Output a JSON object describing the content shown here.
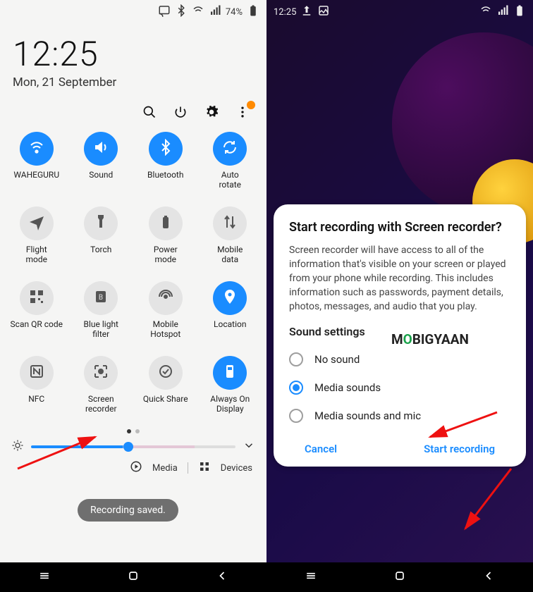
{
  "left": {
    "status": {
      "battery_pct": "74%"
    },
    "clock": {
      "time": "12:25",
      "date": "Mon, 21 September"
    },
    "toolbar": {
      "more_badge": "N"
    },
    "tiles": [
      {
        "id": "wifi",
        "label": "WAHEGURU",
        "on": true
      },
      {
        "id": "sound",
        "label": "Sound",
        "on": true
      },
      {
        "id": "bluetooth",
        "label": "Bluetooth",
        "on": true
      },
      {
        "id": "autorotate",
        "label": "Auto\nrotate",
        "on": true
      },
      {
        "id": "flightmode",
        "label": "Flight\nmode",
        "on": false
      },
      {
        "id": "torch",
        "label": "Torch",
        "on": false
      },
      {
        "id": "powermode",
        "label": "Power\nmode",
        "on": false
      },
      {
        "id": "mobiledata",
        "label": "Mobile\ndata",
        "on": false
      },
      {
        "id": "qrcode",
        "label": "Scan QR code",
        "on": false
      },
      {
        "id": "bluelight",
        "label": "Blue light\nfilter",
        "on": false
      },
      {
        "id": "hotspot",
        "label": "Mobile\nHotspot",
        "on": false
      },
      {
        "id": "location",
        "label": "Location",
        "on": true
      },
      {
        "id": "nfc",
        "label": "NFC",
        "on": false
      },
      {
        "id": "screenrec",
        "label": "Screen\nrecorder",
        "on": false
      },
      {
        "id": "quickshare",
        "label": "Quick Share",
        "on": false
      },
      {
        "id": "aod",
        "label": "Always On\nDisplay",
        "on": true
      }
    ],
    "snackbar": "Recording saved.",
    "bottom": {
      "media": "Media",
      "devices": "Devices"
    }
  },
  "right": {
    "status_time": "12:25",
    "dialog": {
      "title": "Start recording with Screen recorder?",
      "body": "Screen recorder will have access to all of the information that's visible on your screen or played from your phone while recording. This includes information such as passwords, payment details, photos, messages, and audio that you play.",
      "sound_heading": "Sound settings",
      "options": [
        {
          "label": "No sound",
          "selected": false
        },
        {
          "label": "Media sounds",
          "selected": true
        },
        {
          "label": "Media sounds and mic",
          "selected": false
        }
      ],
      "cancel": "Cancel",
      "start": "Start recording"
    }
  },
  "watermark": {
    "pre": "M",
    "o": "O",
    "post": "BIGYAAN"
  }
}
